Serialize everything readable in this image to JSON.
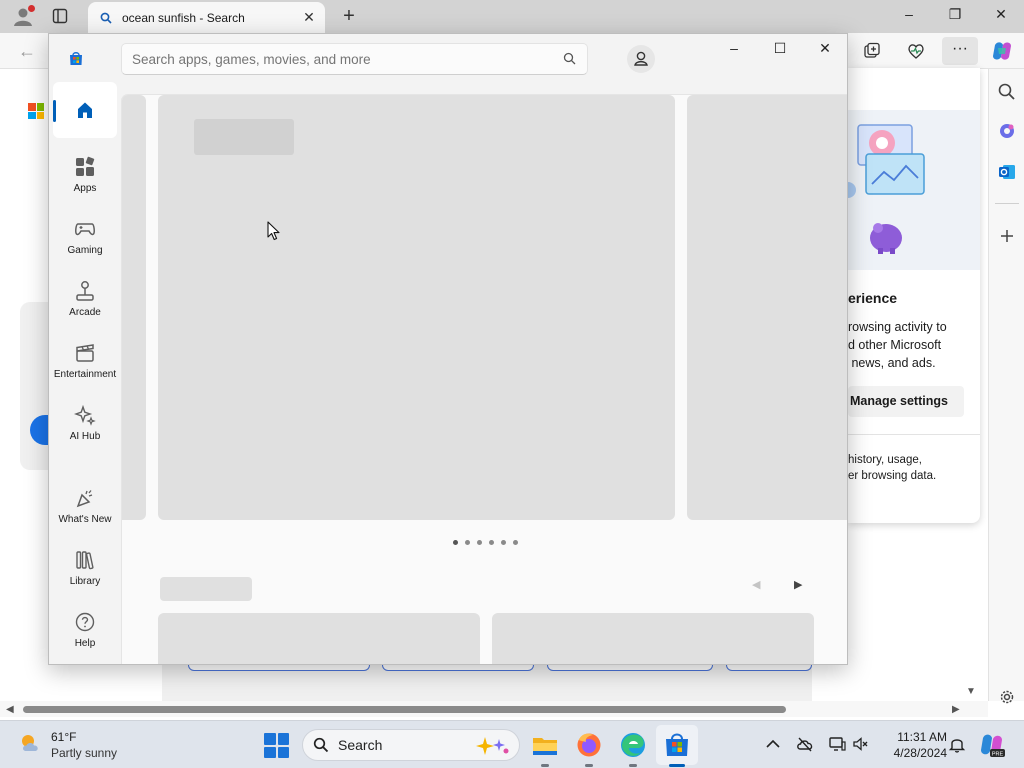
{
  "browser": {
    "tab_title": "ocean sunfish - Search",
    "new_tab_glyph": "+",
    "window_controls": {
      "minimize": "–",
      "maximize": "❐",
      "close": "✕"
    },
    "side_panel": {
      "title": "erience",
      "text": "rowsing activity to\nd other Microsoft\n news, and ads.",
      "button": "Manage settings",
      "text2": "history, usage,\ner browsing data."
    }
  },
  "store": {
    "search_placeholder": "Search apps, games, movies, and more",
    "window_controls": {
      "minimize": "–",
      "maximize": "☐",
      "close": "✕"
    },
    "nav": [
      {
        "id": "home",
        "label": ""
      },
      {
        "id": "apps",
        "label": "Apps"
      },
      {
        "id": "gaming",
        "label": "Gaming"
      },
      {
        "id": "arcade",
        "label": "Arcade"
      },
      {
        "id": "entertainment",
        "label": "Entertainment"
      },
      {
        "id": "ai-hub",
        "label": "AI Hub"
      },
      {
        "id": "whats-new",
        "label": "What's New"
      },
      {
        "id": "library",
        "label": "Library"
      },
      {
        "id": "help",
        "label": "Help"
      }
    ],
    "carousel_pages": 6,
    "carousel_active_page": 1
  },
  "taskbar": {
    "weather_temp": "61°F",
    "weather_condition": "Partly sunny",
    "search_label": "Search",
    "time": "11:31 AM",
    "date": "4/28/2024"
  },
  "colors": {
    "accent": "#005fb8",
    "skeleton": "#e0e0e0",
    "taskbar": "#dfe4ec"
  }
}
